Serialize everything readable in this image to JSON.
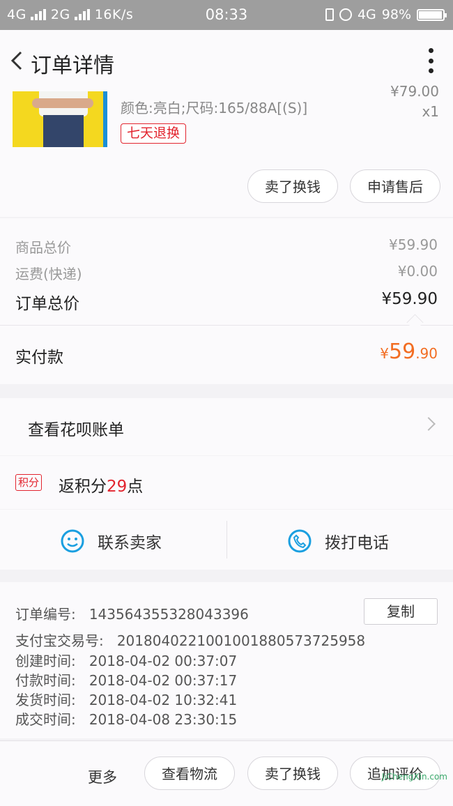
{
  "status_bar": {
    "left": "4G",
    "left2": "2G",
    "speed": "16K/s",
    "time": "08:33",
    "net_right": "4G",
    "battery": "98%"
  },
  "header": {
    "title": "订单详情"
  },
  "product": {
    "price_partial": "¥79.00",
    "quantity": "x1",
    "spec": "颜色:亮白;尺码:165/88A[(S)]",
    "tag": "七天退换",
    "actions": [
      "卖了换钱",
      "申请售后"
    ]
  },
  "summary": {
    "goods_label": "商品总价",
    "goods_value": "¥59.90",
    "shipping_label": "运费(快递)",
    "shipping_value": "¥0.00",
    "total_label": "订单总价",
    "total_value": "¥59.90",
    "paid_label": "实付款",
    "paid_currency": "¥",
    "paid_int": "59",
    "paid_dec": ".90"
  },
  "huabei": {
    "label": "查看花呗账单"
  },
  "points": {
    "tag": "积分",
    "prefix": "返积分",
    "num": "29",
    "suffix": "点"
  },
  "contact": {
    "seller": "联系卖家",
    "call": "拨打电话"
  },
  "order_info": {
    "order_no_label": "订单编号:",
    "order_no": "143564355328043396",
    "copy_label": "复制",
    "alipay_label": "支付宝交易号:",
    "alipay_no": "2018040221001001880573725958",
    "created_label": "创建时间:",
    "created": "2018-04-02 00:37:07",
    "paid_label": "付款时间:",
    "paid": "2018-04-02 00:37:17",
    "shipped_label": "发货时间:",
    "shipped": "2018-04-02 10:32:41",
    "done_label": "成交时间:",
    "done": "2018-04-08 23:30:15"
  },
  "bottom_bar": {
    "more": "更多",
    "buttons": [
      "查看物流",
      "卖了换钱",
      "追加评价"
    ],
    "watermark": "JiChengXin.com"
  },
  "colors": {
    "accent_red": "#e2242e",
    "pay_orange": "#f26d22",
    "icon_blue": "#1a9fe0"
  }
}
